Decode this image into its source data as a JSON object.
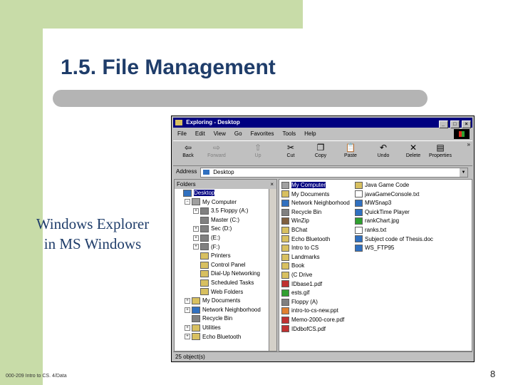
{
  "slide": {
    "title": "1.5. File Management",
    "caption_line1": "Windows Explorer",
    "caption_line2": "in MS Windows",
    "footer": "000-209 Intro to CS. 4/Data",
    "page_number": "8"
  },
  "colors": {
    "accent": "#c8dca8",
    "title": "#1f3d6a",
    "window_title_bg": "#000080"
  },
  "window": {
    "title": "Exploring - Desktop",
    "menus": [
      "File",
      "Edit",
      "View",
      "Go",
      "Favorites",
      "Tools",
      "Help"
    ],
    "toolbar": [
      {
        "label": "Back",
        "icon": "back-arrow-icon",
        "glyph": "⇦",
        "disabled": false
      },
      {
        "label": "Forward",
        "icon": "forward-arrow-icon",
        "glyph": "⇨",
        "disabled": true
      },
      {
        "label": "Up",
        "icon": "up-folder-icon",
        "glyph": "⇧",
        "disabled": true
      },
      {
        "label": "Cut",
        "icon": "scissors-icon",
        "glyph": "✂",
        "disabled": false
      },
      {
        "label": "Copy",
        "icon": "copy-icon",
        "glyph": "❐",
        "disabled": false
      },
      {
        "label": "Paste",
        "icon": "paste-icon",
        "glyph": "📋",
        "disabled": false
      },
      {
        "label": "Undo",
        "icon": "undo-icon",
        "glyph": "↶",
        "disabled": false
      },
      {
        "label": "Delete",
        "icon": "delete-icon",
        "glyph": "✕",
        "disabled": false
      },
      {
        "label": "Properties",
        "icon": "properties-icon",
        "glyph": "▤",
        "disabled": false
      }
    ],
    "address_label": "Address",
    "address_value": "Desktop",
    "folders_header": "Folders",
    "tree": [
      {
        "label": "Desktop",
        "level": 0,
        "expander": "",
        "icon_color": "#3070c0",
        "selected": true
      },
      {
        "label": "My Computer",
        "level": 1,
        "expander": "−",
        "icon_color": "#a0a0a0",
        "selected": false
      },
      {
        "label": "3.5 Floppy (A:)",
        "level": 2,
        "expander": "+",
        "icon_color": "#808080",
        "selected": false
      },
      {
        "label": "Master (C:)",
        "level": 2,
        "expander": "",
        "icon_color": "#808080",
        "selected": false
      },
      {
        "label": "Sec (D:)",
        "level": 2,
        "expander": "+",
        "icon_color": "#808080",
        "selected": false
      },
      {
        "label": "(E:)",
        "level": 2,
        "expander": "+",
        "icon_color": "#808080",
        "selected": false
      },
      {
        "label": "(F:)",
        "level": 2,
        "expander": "+",
        "icon_color": "#808080",
        "selected": false
      },
      {
        "label": "Printers",
        "level": 2,
        "expander": "",
        "icon_color": "#d8c060",
        "selected": false
      },
      {
        "label": "Control Panel",
        "level": 2,
        "expander": "",
        "icon_color": "#d8c060",
        "selected": false
      },
      {
        "label": "Dial-Up Networking",
        "level": 2,
        "expander": "",
        "icon_color": "#d8c060",
        "selected": false
      },
      {
        "label": "Scheduled Tasks",
        "level": 2,
        "expander": "",
        "icon_color": "#d8c060",
        "selected": false
      },
      {
        "label": "Web Folders",
        "level": 2,
        "expander": "",
        "icon_color": "#d8c060",
        "selected": false
      },
      {
        "label": "My Documents",
        "level": 1,
        "expander": "+",
        "icon_color": "#d8c060",
        "selected": false
      },
      {
        "label": "Network Neighborhood",
        "level": 1,
        "expander": "+",
        "icon_color": "#3070c0",
        "selected": false
      },
      {
        "label": "Recycle Bin",
        "level": 1,
        "expander": "",
        "icon_color": "#808080",
        "selected": false
      },
      {
        "label": "Utilities",
        "level": 1,
        "expander": "+",
        "icon_color": "#d8c060",
        "selected": false
      },
      {
        "label": "Echo Bluetooth",
        "level": 1,
        "expander": "+",
        "icon_color": "#d8c060",
        "selected": false
      }
    ],
    "files_col1": [
      {
        "name": "My Computer",
        "icon_color": "#a0a0a0",
        "selected": true
      },
      {
        "name": "My Documents",
        "icon_color": "#d8c060",
        "selected": false
      },
      {
        "name": "Network Neighborhood",
        "icon_color": "#3070c0",
        "selected": false
      },
      {
        "name": "Recycle Bin",
        "icon_color": "#808080",
        "selected": false
      },
      {
        "name": "WinZip",
        "icon_color": "#806040",
        "selected": false
      },
      {
        "name": "BChat",
        "icon_color": "#d8c060",
        "selected": false
      },
      {
        "name": "Echo Bluetooth",
        "icon_color": "#d8c060",
        "selected": false
      },
      {
        "name": "Intro to CS",
        "icon_color": "#d8c060",
        "selected": false
      },
      {
        "name": "Landmarks",
        "icon_color": "#d8c060",
        "selected": false
      },
      {
        "name": "Book",
        "icon_color": "#d8c060",
        "selected": false
      },
      {
        "name": "(C Drive",
        "icon_color": "#d8c060",
        "selected": false
      },
      {
        "name": "IDbase1.pdf",
        "icon_color": "#c03030",
        "selected": false
      },
      {
        "name": "ests.gif",
        "icon_color": "#30a030",
        "selected": false
      },
      {
        "name": "Floppy (A)",
        "icon_color": "#808080",
        "selected": false
      },
      {
        "name": "intro-to-cs-new.ppt",
        "icon_color": "#e08030",
        "selected": false
      },
      {
        "name": "Memo-2000-core.pdf",
        "icon_color": "#c03030",
        "selected": false
      },
      {
        "name": "IDdbofCS.pdf",
        "icon_color": "#c03030",
        "selected": false
      }
    ],
    "files_col2": [
      {
        "name": "Java Game Code",
        "icon_color": "#d8c060",
        "selected": false
      },
      {
        "name": "javaGameConsole.txt",
        "icon_color": "#ffffff",
        "selected": false
      },
      {
        "name": "MWSnap3",
        "icon_color": "#3070c0",
        "selected": false
      },
      {
        "name": "QuickTime Player",
        "icon_color": "#3070c0",
        "selected": false
      },
      {
        "name": "rankChart.jpg",
        "icon_color": "#30a030",
        "selected": false
      },
      {
        "name": "ranks.txt",
        "icon_color": "#ffffff",
        "selected": false
      },
      {
        "name": "Subject code of Thesis.doc",
        "icon_color": "#3070c0",
        "selected": false
      },
      {
        "name": "WS_FTP95",
        "icon_color": "#3070c0",
        "selected": false
      }
    ],
    "status": "25 object(s)"
  }
}
